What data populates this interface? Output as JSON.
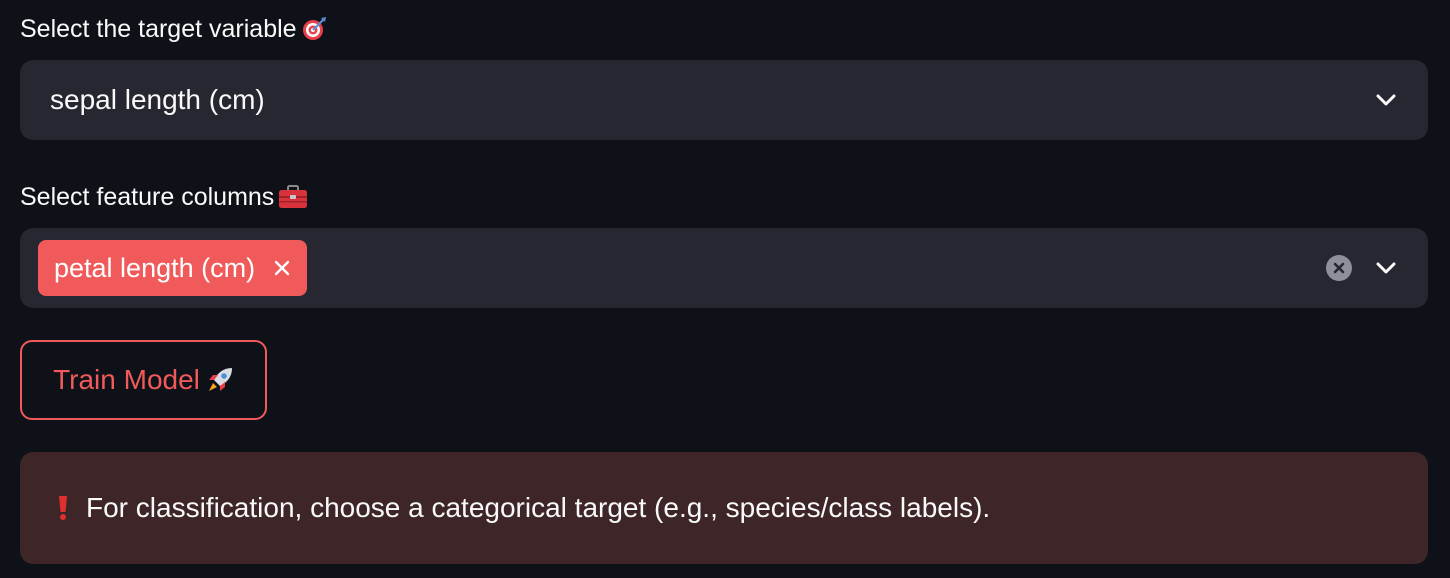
{
  "target_select": {
    "label": "Select the target variable",
    "label_icon": "dart-target-icon",
    "value": "sepal length (cm)"
  },
  "feature_select": {
    "label": "Select feature columns",
    "label_icon": "toolbox-icon",
    "chips": [
      {
        "label": "petal length (cm)"
      }
    ]
  },
  "train_button": {
    "label": "Train Model",
    "icon": "rocket-icon"
  },
  "alert": {
    "icon": "exclamation-icon",
    "text": "For classification, choose a categorical target (e.g., species/class labels)."
  },
  "colors": {
    "background": "#0e1117",
    "input_background": "#262730",
    "accent": "#f05a5a",
    "alert_background": "#3d2528",
    "text": "#fafafa"
  }
}
